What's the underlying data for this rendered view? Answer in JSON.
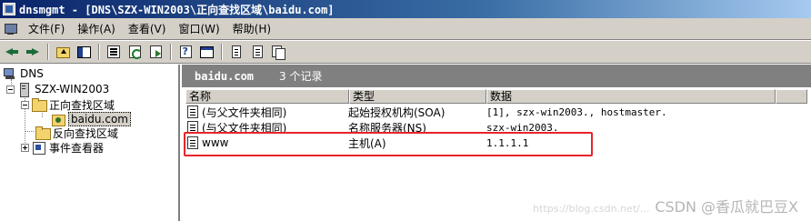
{
  "window": {
    "title": "dnsmgmt - [DNS\\SZX-WIN2003\\正向查找区域\\baidu.com]"
  },
  "menu": [
    "文件(F)",
    "操作(A)",
    "查看(V)",
    "窗口(W)",
    "帮助(H)"
  ],
  "toolbar": {
    "icons": [
      "back-icon",
      "forward-icon",
      "up-folder-icon",
      "show-hide-tree-icon",
      "properties-icon",
      "refresh-icon",
      "export-list-icon",
      "help-icon",
      "show-hide-action-pane-icon",
      "new-record-icon",
      "new-record-alt-icon",
      "new-other-records-icon"
    ]
  },
  "tree": {
    "root": "DNS",
    "server": "SZX-WIN2003",
    "forward_zone": "正向查找区域",
    "zone": "baidu.com",
    "reverse_zone": "反向查找区域",
    "event_viewer": "事件查看器"
  },
  "detail": {
    "zone_name": "baidu.com",
    "record_count": "3 个记录",
    "columns": [
      "名称",
      "类型",
      "数据"
    ],
    "rows": [
      {
        "name": "(与父文件夹相同)",
        "type": "起始授权机构(SOA)",
        "data": "[1], szx-win2003., hostmaster."
      },
      {
        "name": "(与父文件夹相同)",
        "type": "名称服务器(NS)",
        "data": "szx-win2003."
      },
      {
        "name": "www",
        "type": "主机(A)",
        "data": "1.1.1.1"
      }
    ]
  },
  "annotation": {
    "highlight_color": "#e8242a"
  },
  "watermark": {
    "faint": "https://blog.csdn.net/...",
    "text": "CSDN @香瓜就巴豆X"
  }
}
